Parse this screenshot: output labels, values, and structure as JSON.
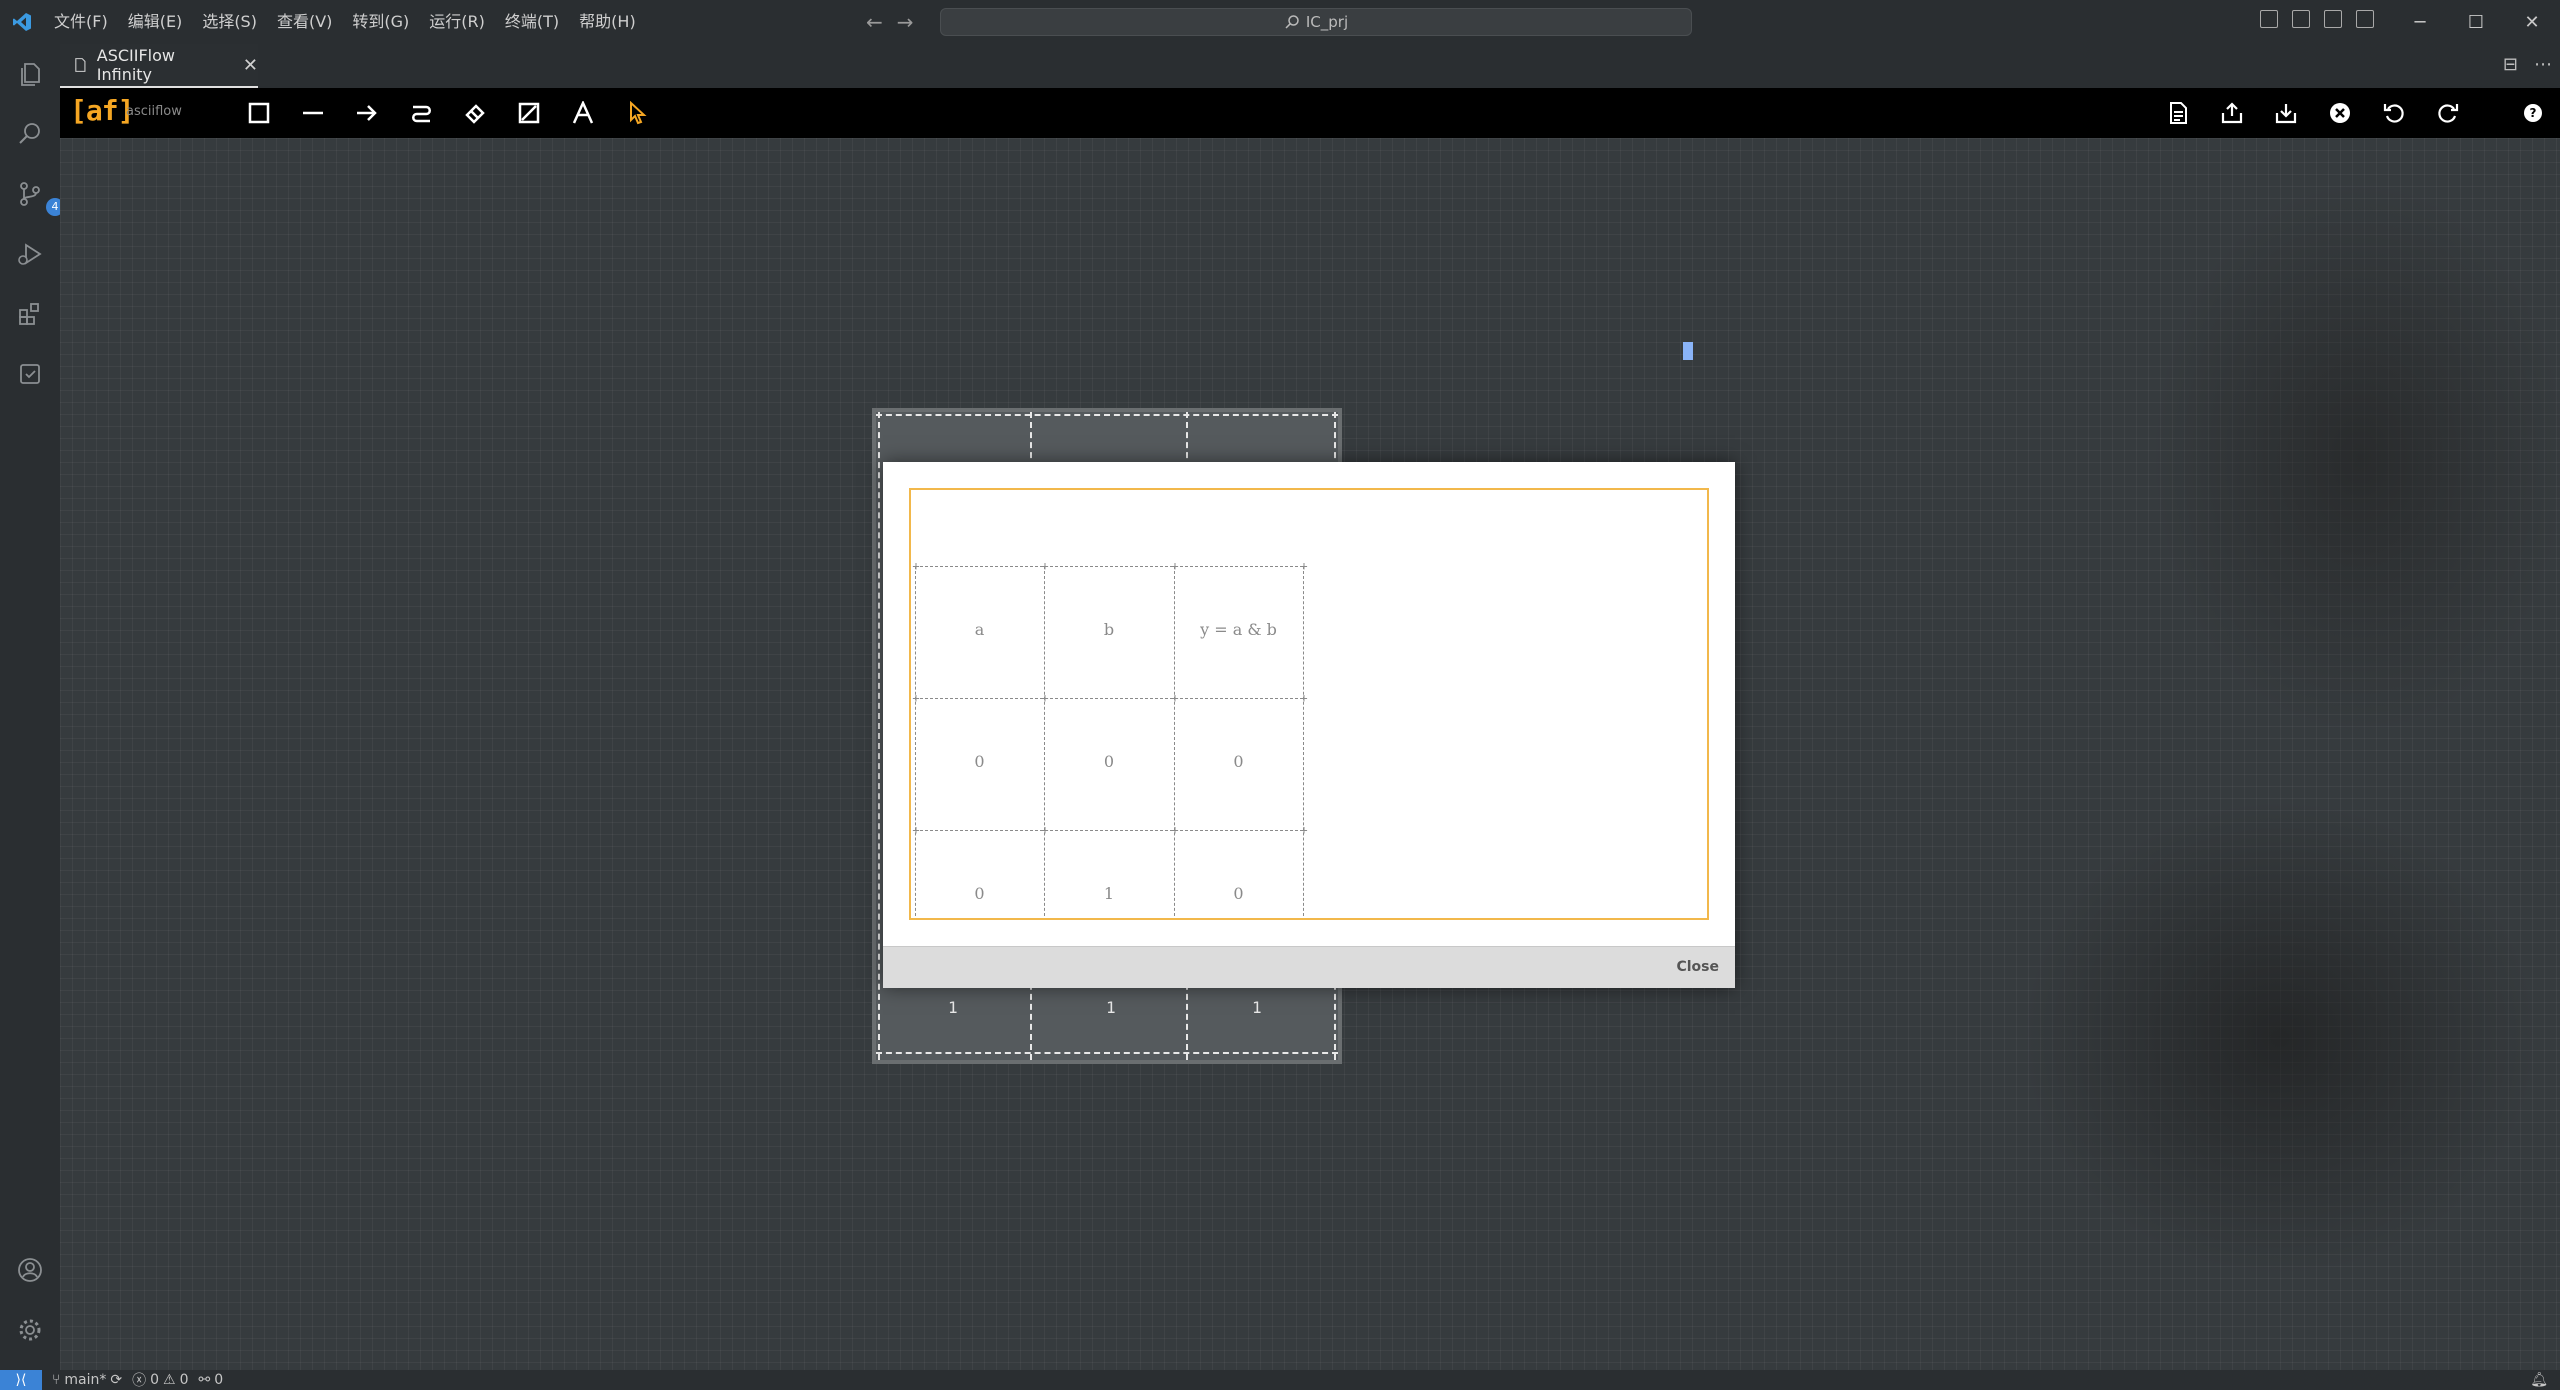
{
  "menus": [
    "文件(F)",
    "编辑(E)",
    "选择(S)",
    "查看(V)",
    "转到(G)",
    "运行(R)",
    "终端(T)",
    "帮助(H)"
  ],
  "command_center": "IC_prj",
  "tab": {
    "label": "ASCIIFlow Infinity"
  },
  "asciiflow": {
    "logo": "[af]",
    "logo_text": "asciiflow"
  },
  "source_control_badge": "4",
  "background_table": {
    "last_row": [
      "1",
      "1",
      "1"
    ]
  },
  "dialog": {
    "close_label": "Close",
    "table": {
      "header": [
        "a",
        "b",
        "y = a & b"
      ],
      "rows": [
        [
          "0",
          "0",
          "0"
        ],
        [
          "0",
          "1",
          "0"
        ]
      ]
    }
  },
  "status": {
    "branch": "main*",
    "errors": "0",
    "warnings": "0",
    "ports": "0"
  }
}
